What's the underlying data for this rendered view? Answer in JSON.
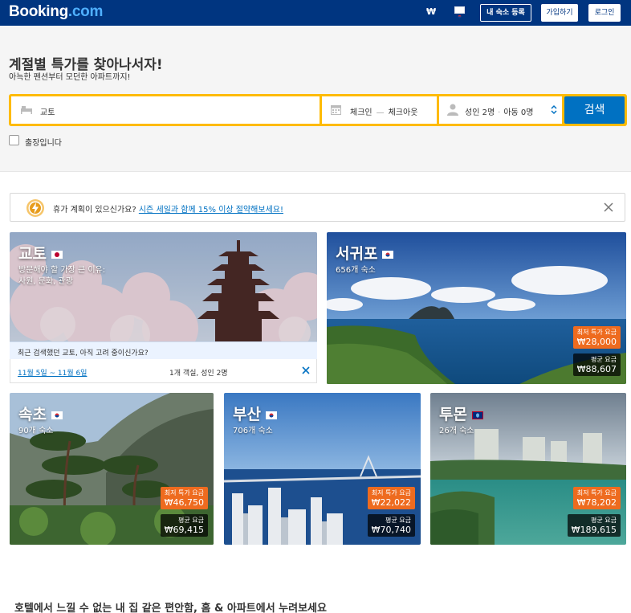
{
  "header": {
    "logo_main": "Booking",
    "logo_suffix": ".com",
    "currency": "₩",
    "list_property": "내 숙소 등록",
    "register": "가입하기",
    "login": "로그인"
  },
  "hero": {
    "title": "계절별 특가를 찾아나서자!",
    "subtitle": "아늑한 펜션부터 모던한 아파트까지!"
  },
  "search": {
    "destination": "교토",
    "checkin": "체크인",
    "checkout": "체크아웃",
    "adults": "성인 2명",
    "children": "아동 0명",
    "button": "검색",
    "business_trip": "출장입니다"
  },
  "banner": {
    "text": "휴가 계획이 있으신가요?",
    "link": "시즌 세일과 함께 15% 이상 절약해보세요!"
  },
  "tiles": {
    "kyoto": {
      "title": "교토",
      "line1": "방문해야 할 가장 큰 이유:",
      "line2": "사원, 문화, 관광",
      "recent": "최근 검색했던 교토, 아직 고려 중이신가요?",
      "dates": "11월 5일 ~ 11월 6일",
      "guests": "1개 객실, 성인 2명"
    },
    "seogwipo": {
      "title": "서귀포",
      "count": "656개 숙소",
      "deal_label": "최저 특가 요금",
      "deal_value": "₩28,000",
      "avg_label": "평균 요금",
      "avg_value": "₩88,607"
    },
    "sokcho": {
      "title": "속초",
      "count": "90개 숙소",
      "deal_label": "최저 특가 요금",
      "deal_value": "₩46,750",
      "avg_label": "평균 요금",
      "avg_value": "₩69,415"
    },
    "busan": {
      "title": "부산",
      "count": "706개 숙소",
      "deal_label": "최저 특가 요금",
      "deal_value": "₩22,022",
      "avg_label": "평균 요금",
      "avg_value": "₩70,740"
    },
    "tumon": {
      "title": "투몬",
      "count": "26개 숙소",
      "deal_label": "최저 특가 요금",
      "deal_value": "₩78,202",
      "avg_label": "평균 요금",
      "avg_value": "₩189,615"
    }
  },
  "footer_heading": "호텔에서 느낄 수 없는 내 집 같은 편안함, 홈 & 아파트에서 누려보세요",
  "colors": {
    "brand_dark": "#003580",
    "search_border": "#febb02",
    "search_button": "#0071c2",
    "deal": "#ee6b1f"
  }
}
